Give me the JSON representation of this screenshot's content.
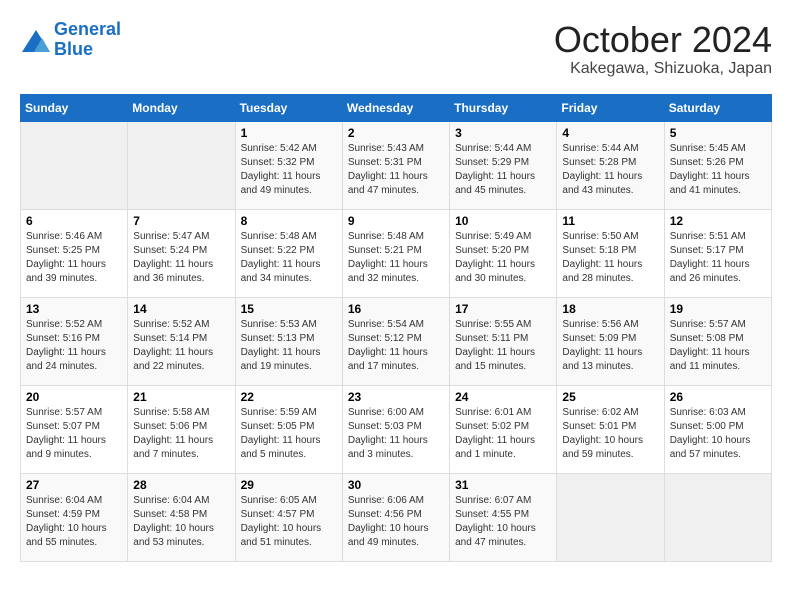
{
  "logo": {
    "line1": "General",
    "line2": "Blue"
  },
  "title": "October 2024",
  "location": "Kakegawa, Shizuoka, Japan",
  "weekdays": [
    "Sunday",
    "Monday",
    "Tuesday",
    "Wednesday",
    "Thursday",
    "Friday",
    "Saturday"
  ],
  "weeks": [
    [
      {
        "day": "",
        "sunrise": "",
        "sunset": "",
        "daylight": ""
      },
      {
        "day": "",
        "sunrise": "",
        "sunset": "",
        "daylight": ""
      },
      {
        "day": "1",
        "sunrise": "Sunrise: 5:42 AM",
        "sunset": "Sunset: 5:32 PM",
        "daylight": "Daylight: 11 hours and 49 minutes."
      },
      {
        "day": "2",
        "sunrise": "Sunrise: 5:43 AM",
        "sunset": "Sunset: 5:31 PM",
        "daylight": "Daylight: 11 hours and 47 minutes."
      },
      {
        "day": "3",
        "sunrise": "Sunrise: 5:44 AM",
        "sunset": "Sunset: 5:29 PM",
        "daylight": "Daylight: 11 hours and 45 minutes."
      },
      {
        "day": "4",
        "sunrise": "Sunrise: 5:44 AM",
        "sunset": "Sunset: 5:28 PM",
        "daylight": "Daylight: 11 hours and 43 minutes."
      },
      {
        "day": "5",
        "sunrise": "Sunrise: 5:45 AM",
        "sunset": "Sunset: 5:26 PM",
        "daylight": "Daylight: 11 hours and 41 minutes."
      }
    ],
    [
      {
        "day": "6",
        "sunrise": "Sunrise: 5:46 AM",
        "sunset": "Sunset: 5:25 PM",
        "daylight": "Daylight: 11 hours and 39 minutes."
      },
      {
        "day": "7",
        "sunrise": "Sunrise: 5:47 AM",
        "sunset": "Sunset: 5:24 PM",
        "daylight": "Daylight: 11 hours and 36 minutes."
      },
      {
        "day": "8",
        "sunrise": "Sunrise: 5:48 AM",
        "sunset": "Sunset: 5:22 PM",
        "daylight": "Daylight: 11 hours and 34 minutes."
      },
      {
        "day": "9",
        "sunrise": "Sunrise: 5:48 AM",
        "sunset": "Sunset: 5:21 PM",
        "daylight": "Daylight: 11 hours and 32 minutes."
      },
      {
        "day": "10",
        "sunrise": "Sunrise: 5:49 AM",
        "sunset": "Sunset: 5:20 PM",
        "daylight": "Daylight: 11 hours and 30 minutes."
      },
      {
        "day": "11",
        "sunrise": "Sunrise: 5:50 AM",
        "sunset": "Sunset: 5:18 PM",
        "daylight": "Daylight: 11 hours and 28 minutes."
      },
      {
        "day": "12",
        "sunrise": "Sunrise: 5:51 AM",
        "sunset": "Sunset: 5:17 PM",
        "daylight": "Daylight: 11 hours and 26 minutes."
      }
    ],
    [
      {
        "day": "13",
        "sunrise": "Sunrise: 5:52 AM",
        "sunset": "Sunset: 5:16 PM",
        "daylight": "Daylight: 11 hours and 24 minutes."
      },
      {
        "day": "14",
        "sunrise": "Sunrise: 5:52 AM",
        "sunset": "Sunset: 5:14 PM",
        "daylight": "Daylight: 11 hours and 22 minutes."
      },
      {
        "day": "15",
        "sunrise": "Sunrise: 5:53 AM",
        "sunset": "Sunset: 5:13 PM",
        "daylight": "Daylight: 11 hours and 19 minutes."
      },
      {
        "day": "16",
        "sunrise": "Sunrise: 5:54 AM",
        "sunset": "Sunset: 5:12 PM",
        "daylight": "Daylight: 11 hours and 17 minutes."
      },
      {
        "day": "17",
        "sunrise": "Sunrise: 5:55 AM",
        "sunset": "Sunset: 5:11 PM",
        "daylight": "Daylight: 11 hours and 15 minutes."
      },
      {
        "day": "18",
        "sunrise": "Sunrise: 5:56 AM",
        "sunset": "Sunset: 5:09 PM",
        "daylight": "Daylight: 11 hours and 13 minutes."
      },
      {
        "day": "19",
        "sunrise": "Sunrise: 5:57 AM",
        "sunset": "Sunset: 5:08 PM",
        "daylight": "Daylight: 11 hours and 11 minutes."
      }
    ],
    [
      {
        "day": "20",
        "sunrise": "Sunrise: 5:57 AM",
        "sunset": "Sunset: 5:07 PM",
        "daylight": "Daylight: 11 hours and 9 minutes."
      },
      {
        "day": "21",
        "sunrise": "Sunrise: 5:58 AM",
        "sunset": "Sunset: 5:06 PM",
        "daylight": "Daylight: 11 hours and 7 minutes."
      },
      {
        "day": "22",
        "sunrise": "Sunrise: 5:59 AM",
        "sunset": "Sunset: 5:05 PM",
        "daylight": "Daylight: 11 hours and 5 minutes."
      },
      {
        "day": "23",
        "sunrise": "Sunrise: 6:00 AM",
        "sunset": "Sunset: 5:03 PM",
        "daylight": "Daylight: 11 hours and 3 minutes."
      },
      {
        "day": "24",
        "sunrise": "Sunrise: 6:01 AM",
        "sunset": "Sunset: 5:02 PM",
        "daylight": "Daylight: 11 hours and 1 minute."
      },
      {
        "day": "25",
        "sunrise": "Sunrise: 6:02 AM",
        "sunset": "Sunset: 5:01 PM",
        "daylight": "Daylight: 10 hours and 59 minutes."
      },
      {
        "day": "26",
        "sunrise": "Sunrise: 6:03 AM",
        "sunset": "Sunset: 5:00 PM",
        "daylight": "Daylight: 10 hours and 57 minutes."
      }
    ],
    [
      {
        "day": "27",
        "sunrise": "Sunrise: 6:04 AM",
        "sunset": "Sunset: 4:59 PM",
        "daylight": "Daylight: 10 hours and 55 minutes."
      },
      {
        "day": "28",
        "sunrise": "Sunrise: 6:04 AM",
        "sunset": "Sunset: 4:58 PM",
        "daylight": "Daylight: 10 hours and 53 minutes."
      },
      {
        "day": "29",
        "sunrise": "Sunrise: 6:05 AM",
        "sunset": "Sunset: 4:57 PM",
        "daylight": "Daylight: 10 hours and 51 minutes."
      },
      {
        "day": "30",
        "sunrise": "Sunrise: 6:06 AM",
        "sunset": "Sunset: 4:56 PM",
        "daylight": "Daylight: 10 hours and 49 minutes."
      },
      {
        "day": "31",
        "sunrise": "Sunrise: 6:07 AM",
        "sunset": "Sunset: 4:55 PM",
        "daylight": "Daylight: 10 hours and 47 minutes."
      },
      {
        "day": "",
        "sunrise": "",
        "sunset": "",
        "daylight": ""
      },
      {
        "day": "",
        "sunrise": "",
        "sunset": "",
        "daylight": ""
      }
    ]
  ]
}
